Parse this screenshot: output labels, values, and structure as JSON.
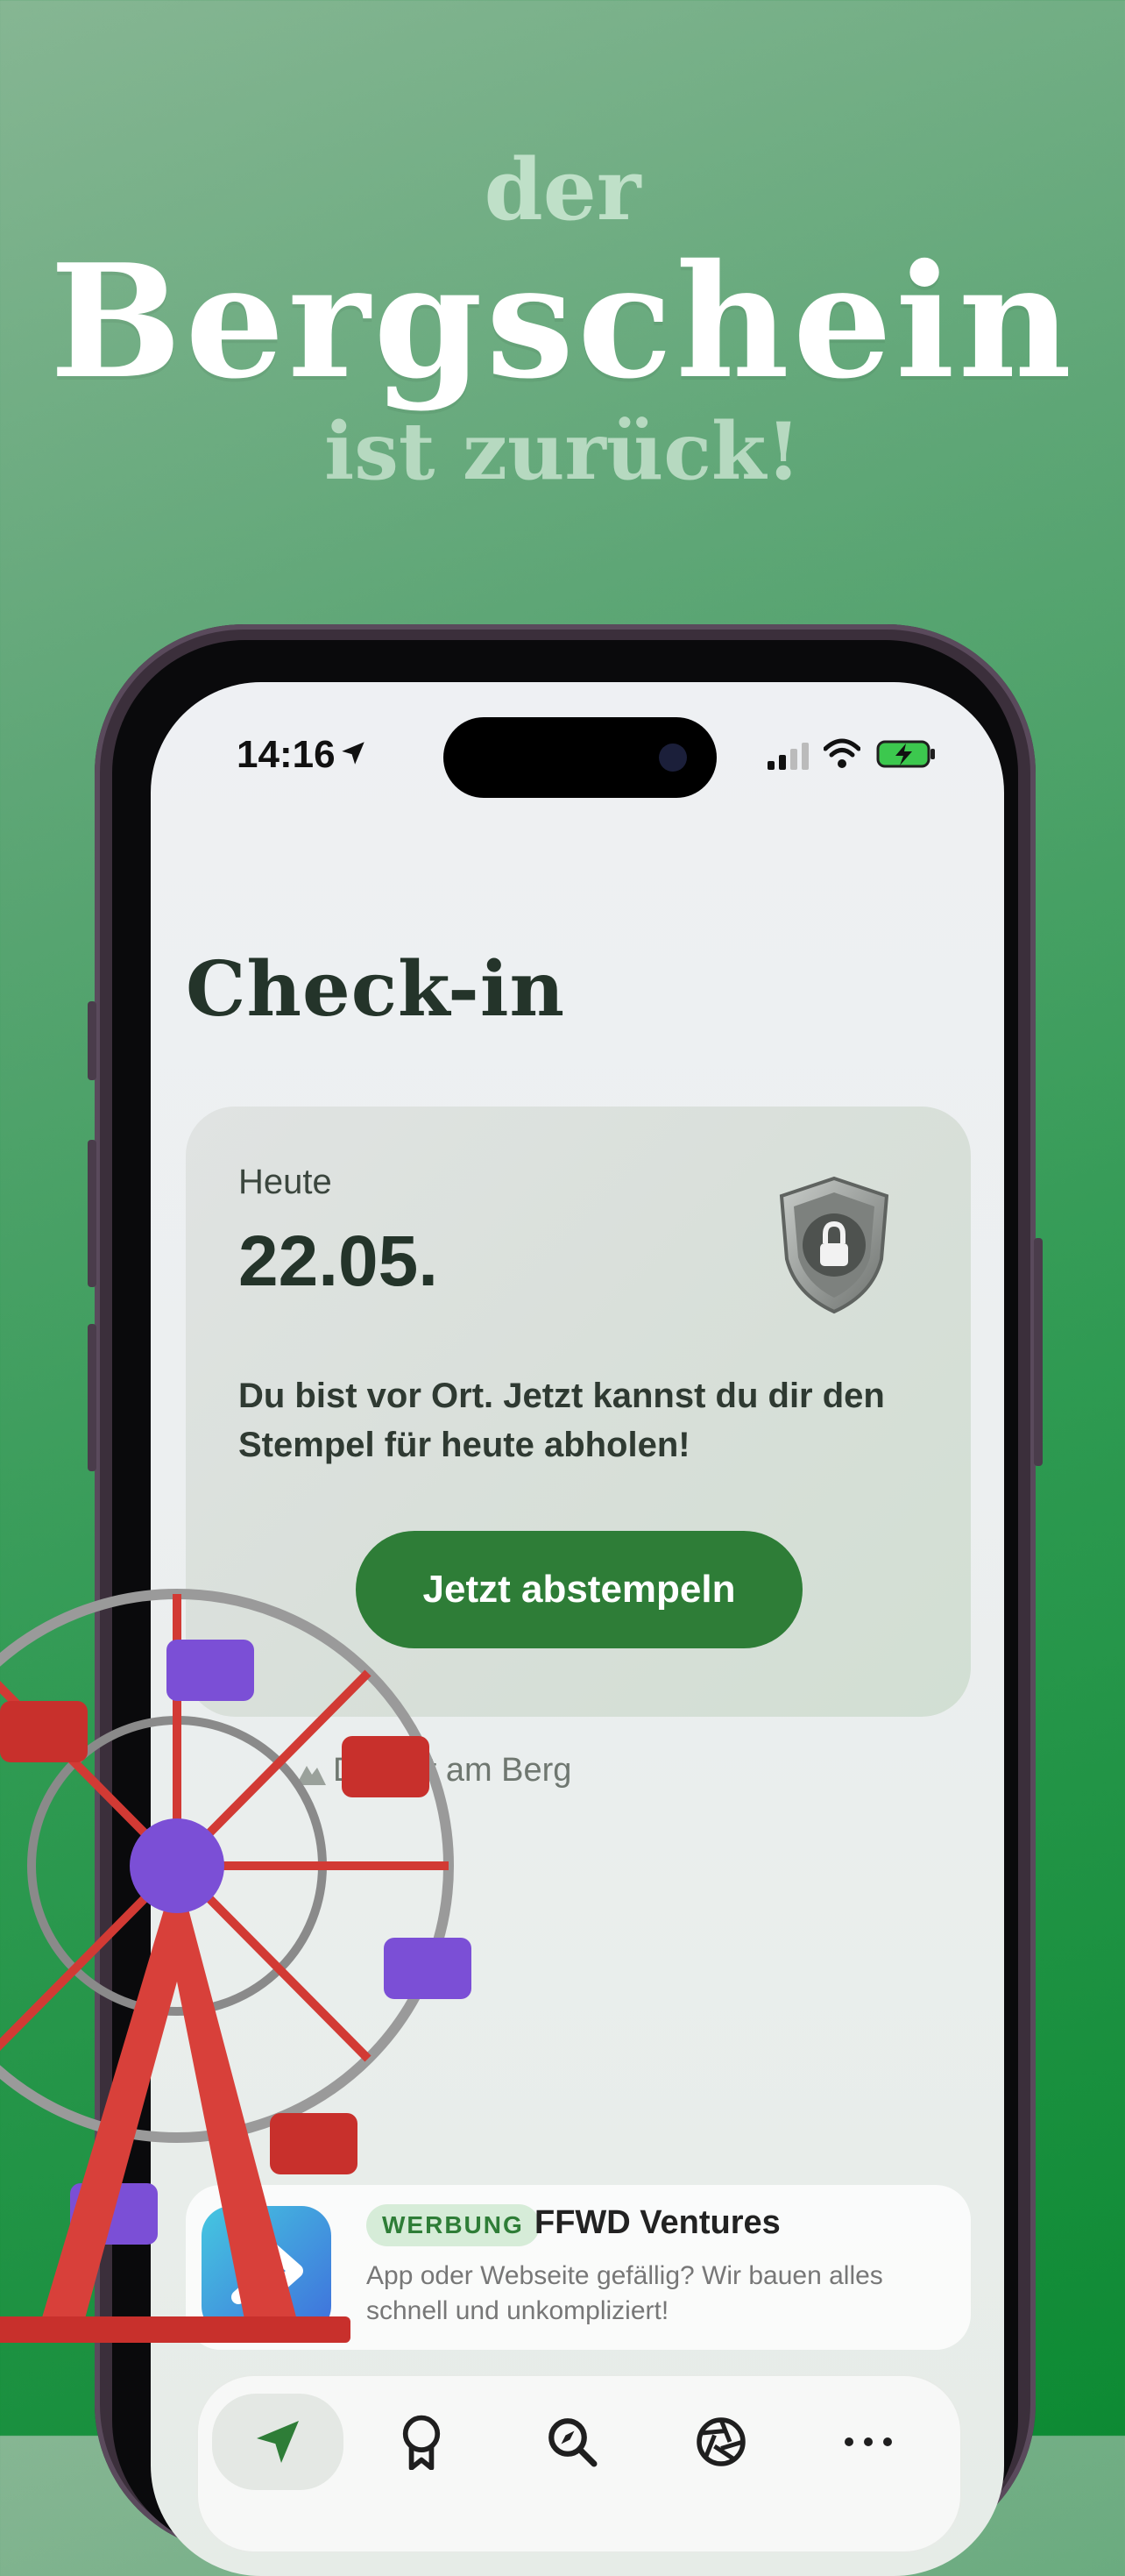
{
  "hero": {
    "line1": "der",
    "line2": "Bergschein",
    "line3": "ist zurück!"
  },
  "status_bar": {
    "time": "14:16",
    "icons": [
      "location-arrow-icon",
      "cellular-signal-icon",
      "wifi-icon",
      "battery-charging-icon"
    ]
  },
  "screen": {
    "title": "Check-in",
    "card": {
      "today_label": "Heute",
      "date": "22.05.",
      "badge_icon": "locked-shield-badge-icon",
      "message": "Du bist vor Ort. Jetzt kannst du dir den Stempel für heute abholen!",
      "button_label": "Jetzt abstempeln"
    },
    "location_status": "Du bist am Berg",
    "ad": {
      "tag": "WERBUNG",
      "name": "FFWD Ventures",
      "description": "App oder Webseite gefällig? Wir bauen alles schnell und unkompliziert!"
    },
    "tabs": [
      {
        "icon": "location-arrow-icon",
        "active": true
      },
      {
        "icon": "award-ribbon-icon",
        "active": false
      },
      {
        "icon": "explore-magnifier-icon",
        "active": false
      },
      {
        "icon": "aperture-icon",
        "active": false
      },
      {
        "icon": "more-dots-icon",
        "active": false
      }
    ]
  },
  "colors": {
    "accent": "#2e7d37",
    "title_dark": "#24342a",
    "background_green": "#2f9a52"
  }
}
